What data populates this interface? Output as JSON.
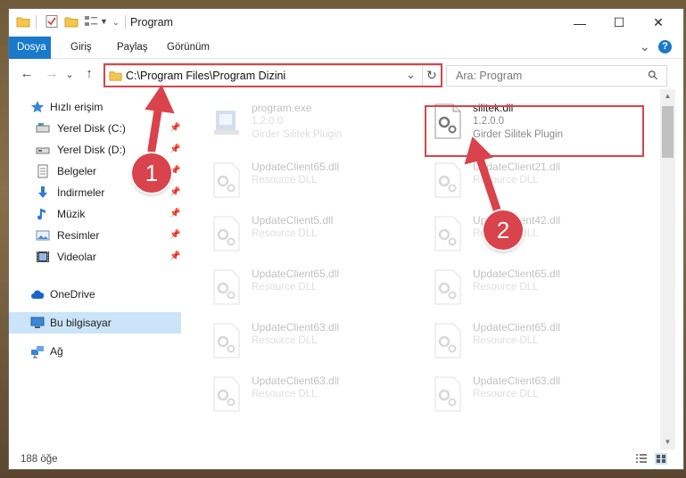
{
  "window": {
    "title": "Program",
    "minimize_glyph": "—",
    "maximize_glyph": "☐",
    "close_glyph": "✕"
  },
  "ribbon": {
    "tabs": [
      {
        "label": "Dosya"
      },
      {
        "label": "Giriş"
      },
      {
        "label": "Paylaş"
      },
      {
        "label": "Görünüm"
      }
    ],
    "expand_glyph": "⌄",
    "help_glyph": "?"
  },
  "address": {
    "path": "C:\\Program Files\\Program Dizini",
    "back_glyph": "←",
    "forward_glyph": "→",
    "recent_glyph": "⌄",
    "up_glyph": "↑",
    "dropdown_glyph": "⌄",
    "refresh_glyph": "↻"
  },
  "search": {
    "placeholder": "Ara: Program",
    "icon": "search-icon",
    "glyph": "⚲"
  },
  "nav": {
    "quick_access": "Hızlı erişim",
    "items": [
      {
        "label": "Yerel Disk (C:)",
        "icon": "drive-icon"
      },
      {
        "label": "Yerel Disk (D:)",
        "icon": "drive-icon"
      },
      {
        "label": "Belgeler",
        "icon": "documents-icon"
      },
      {
        "label": "İndirmeler",
        "icon": "downloads-icon"
      },
      {
        "label": "Müzik",
        "icon": "music-icon"
      },
      {
        "label": "Resimler",
        "icon": "pictures-icon"
      },
      {
        "label": "Videolar",
        "icon": "videos-icon"
      }
    ],
    "pin_glyph": "📌",
    "onedrive": "OneDrive",
    "this_pc": "Bu bilgisayar",
    "network": "Ağ"
  },
  "files": [
    {
      "name": "program.exe",
      "line1": "1.2.0.0",
      "line2": "Girder Silitek Plugin",
      "faded": true,
      "icon": "exe-icon"
    },
    {
      "name": "silitek.dll",
      "line1": "1.2.0.0",
      "line2": "Girder Silitek Plugin",
      "faded": false,
      "icon": "dll-icon"
    },
    {
      "name": "UpdateClient65.dll",
      "line1": "Resource DLL",
      "faded": true,
      "icon": "dll-icon"
    },
    {
      "name": "UpdateClient21.dll",
      "line1": "Resource DLL",
      "faded": true,
      "icon": "dll-icon"
    },
    {
      "name": "UpdateClient5.dll",
      "line1": "Resource DLL",
      "faded": true,
      "icon": "dll-icon"
    },
    {
      "name": "UpdateClient42.dll",
      "line1": "Resource DLL",
      "faded": true,
      "icon": "dll-icon"
    },
    {
      "name": "UpdateClient65.dll",
      "line1": "Resource DLL",
      "faded": true,
      "icon": "dll-icon"
    },
    {
      "name": "UpdateClient65.dll",
      "line1": "Resource DLL",
      "faded": true,
      "icon": "dll-icon"
    },
    {
      "name": "UpdateClient63.dll",
      "line1": "Resource DLL",
      "faded": true,
      "icon": "dll-icon"
    },
    {
      "name": "UpdateClient65.dll",
      "line1": "Resource DLL",
      "faded": true,
      "icon": "dll-icon"
    },
    {
      "name": "UpdateClient63.dll",
      "line1": "Resource DLL",
      "faded": true,
      "icon": "dll-icon"
    },
    {
      "name": "UpdateClient63.dll",
      "line1": "Resource DLL",
      "faded": true,
      "icon": "dll-icon"
    }
  ],
  "status": {
    "item_count": "188 öğe"
  },
  "annotations": {
    "step1": "1",
    "step2": "2",
    "accent_color": "#d9434c"
  },
  "colors": {
    "file_tab": "#1979ca",
    "selection": "#cce4f7"
  }
}
